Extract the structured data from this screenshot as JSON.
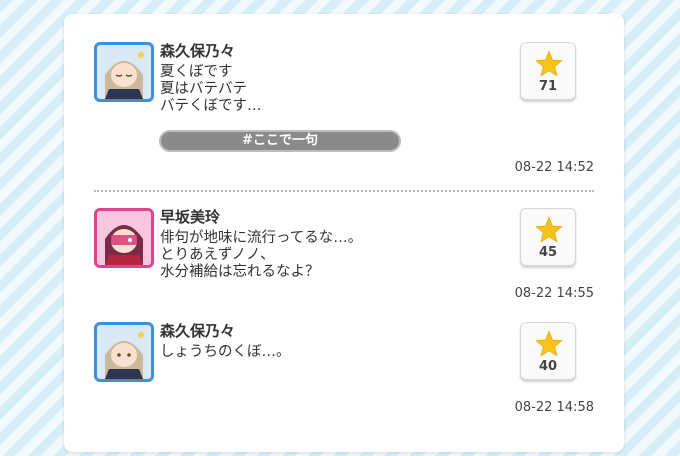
{
  "posts": [
    {
      "name": "森久保乃々",
      "message": "夏くぼです\n夏はバテバテ\nバテくぼです…",
      "tag": "#ここで一句",
      "stars": "71",
      "time": "08-22 14:52"
    },
    {
      "name": "早坂美玲",
      "message": "俳句が地味に流行ってるな…。\nとりあえずノノ、\n水分補給は忘れるなよ？",
      "stars": "45",
      "time": "08-22 14:55"
    },
    {
      "name": "森久保乃々",
      "message": "しょうちのくぼ…。",
      "stars": "40",
      "time": "08-22 14:58"
    }
  ],
  "colors": {
    "star": "#f7c21a",
    "accent_blue": "#3d8fe0",
    "accent_pink": "#e4428f"
  },
  "icons": {
    "star": "star-icon",
    "avatar_1": "avatar-morikubo-nono",
    "avatar_2": "avatar-hayasaka-mirei",
    "avatar_3": "avatar-morikubo-nono"
  }
}
